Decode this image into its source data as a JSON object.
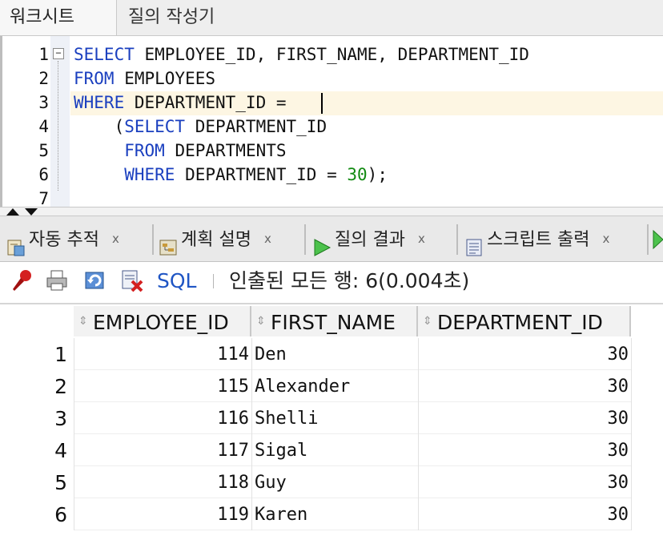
{
  "top_tabs": {
    "worksheet": "워크시트",
    "query_builder": "질의 작성기"
  },
  "editor": {
    "line_numbers": [
      "1",
      "2",
      "3",
      "4",
      "5",
      "6",
      "7"
    ],
    "lines": [
      [
        {
          "t": "kw",
          "v": "SELECT"
        },
        {
          "t": "tx",
          "v": " EMPLOYEE_ID, FIRST_NAME, DEPARTMENT_ID"
        }
      ],
      [
        {
          "t": "kw",
          "v": "FROM"
        },
        {
          "t": "tx",
          "v": " EMPLOYEES"
        }
      ],
      [
        {
          "t": "kw",
          "v": "WHERE"
        },
        {
          "t": "tx",
          "v": " DEPARTMENT_ID = "
        }
      ],
      [
        {
          "t": "tx",
          "v": "    ("
        },
        {
          "t": "kw",
          "v": "SELECT"
        },
        {
          "t": "tx",
          "v": " DEPARTMENT_ID"
        }
      ],
      [
        {
          "t": "tx",
          "v": "     "
        },
        {
          "t": "kw",
          "v": "FROM"
        },
        {
          "t": "tx",
          "v": " DEPARTMENTS"
        }
      ],
      [
        {
          "t": "tx",
          "v": "     "
        },
        {
          "t": "kw",
          "v": "WHERE"
        },
        {
          "t": "tx",
          "v": " DEPARTMENT_ID = "
        },
        {
          "t": "num",
          "v": "30"
        },
        {
          "t": "tx",
          "v": ");"
        }
      ],
      []
    ]
  },
  "result_tabs": [
    {
      "label": "자동 추적",
      "close": "x",
      "icon": "autotrace-icon"
    },
    {
      "label": "계획 설명",
      "close": "x",
      "icon": "explain-plan-icon"
    },
    {
      "label": "질의 결과",
      "close": "x",
      "icon": "play-icon"
    },
    {
      "label": "스크립트 출력",
      "close": "x",
      "icon": "script-output-icon"
    }
  ],
  "toolbar": {
    "sql_label": "SQL",
    "status": "인출된 모든 행: 6(0.004초)",
    "icons": [
      "pin-icon",
      "print-icon",
      "refresh-icon",
      "delete-icon"
    ]
  },
  "grid": {
    "columns": [
      "EMPLOYEE_ID",
      "FIRST_NAME",
      "DEPARTMENT_ID"
    ],
    "rows": [
      {
        "n": "1",
        "id": "114",
        "name": "Den",
        "dept": "30"
      },
      {
        "n": "2",
        "id": "115",
        "name": "Alexander",
        "dept": "30"
      },
      {
        "n": "3",
        "id": "116",
        "name": "Shelli",
        "dept": "30"
      },
      {
        "n": "4",
        "id": "117",
        "name": "Sigal",
        "dept": "30"
      },
      {
        "n": "5",
        "id": "118",
        "name": "Guy",
        "dept": "30"
      },
      {
        "n": "6",
        "id": "119",
        "name": "Karen",
        "dept": "30"
      }
    ]
  },
  "colors": {
    "keyword": "#1a3fbf",
    "number": "#118a11",
    "link": "#1f55c4",
    "current_line": "#fdf6e3"
  }
}
